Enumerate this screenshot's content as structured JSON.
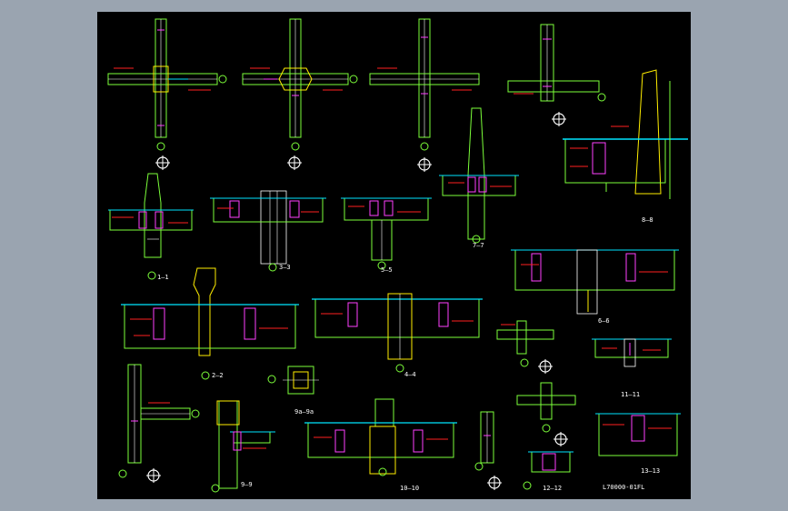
{
  "viewport": {
    "background": "#9aa4b0",
    "drawing_background": "#000000"
  },
  "colors": {
    "green": "#7cff3a",
    "white": "#ffffff",
    "red": "#ff2020",
    "yellow": "#ffee00",
    "cyan": "#00e5ff",
    "magenta": "#ff40ff"
  },
  "section_labels": {
    "s1": "1—1",
    "s2": "2—2",
    "s3": "3—3",
    "s4": "4—4",
    "s5": "5—5",
    "s6": "6—6",
    "s7": "7—7",
    "s8": "8—8",
    "s9": "9—9",
    "s9a": "9a—9a",
    "s10": "10—10",
    "s11": "11—11",
    "s12": "12—12",
    "s13": "13—13"
  },
  "title_block": {
    "caption": "L70000-01FL"
  }
}
